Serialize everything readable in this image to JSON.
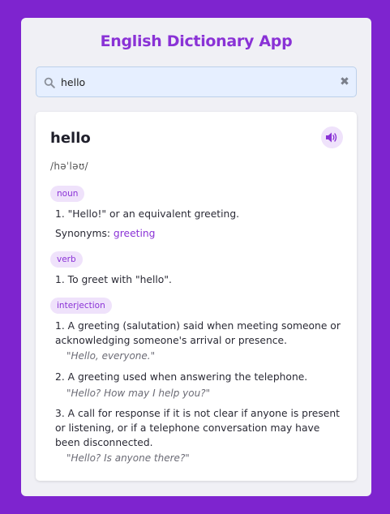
{
  "app_title": "English Dictionary App",
  "search": {
    "value": "hello",
    "placeholder": ""
  },
  "entry": {
    "word": "hello",
    "phonetic": "/həˈləʊ/",
    "meanings": [
      {
        "part_of_speech": "noun",
        "definitions": [
          {
            "text": "1. \"Hello!\" or an equivalent greeting."
          }
        ],
        "synonyms_label": "Synonyms:",
        "synonyms": [
          "greeting"
        ]
      },
      {
        "part_of_speech": "verb",
        "definitions": [
          {
            "text": "1. To greet with \"hello\"."
          }
        ]
      },
      {
        "part_of_speech": "interjection",
        "definitions": [
          {
            "text": "1. A greeting (salutation) said when meeting someone or acknowledging someone's arrival or presence.",
            "example": "\"Hello, everyone.\""
          },
          {
            "text": "2. A greeting used when answering the telephone.",
            "example": "\"Hello? How may I help you?\""
          },
          {
            "text": "3. A call for response if it is not clear if anyone is present or listening, or if a telephone conversation may have been disconnected.",
            "example": "\"Hello? Is anyone there?\""
          }
        ]
      }
    ]
  },
  "icons": {
    "search": "search-icon",
    "clear": "close-icon",
    "audio": "speaker-icon"
  },
  "colors": {
    "background": "#7e24cf",
    "accent": "#8a32d6",
    "badge_bg": "#efe2fb",
    "search_bg": "#e6efff"
  }
}
